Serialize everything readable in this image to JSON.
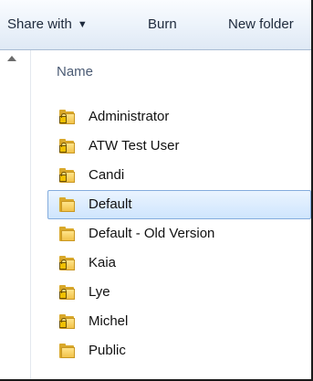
{
  "toolbar": {
    "share_with_label": "Share with",
    "burn_label": "Burn",
    "new_folder_label": "New folder"
  },
  "list": {
    "column_header": "Name",
    "items": [
      {
        "name": "Administrator",
        "icon": "locked-folder-icon"
      },
      {
        "name": "ATW Test User",
        "icon": "locked-folder-icon"
      },
      {
        "name": "Candi",
        "icon": "locked-folder-icon"
      },
      {
        "name": "Default",
        "icon": "folder-icon",
        "selected": true
      },
      {
        "name": "Default - Old Version",
        "icon": "folder-icon"
      },
      {
        "name": "Kaia",
        "icon": "locked-folder-icon"
      },
      {
        "name": "Lye",
        "icon": "locked-folder-icon"
      },
      {
        "name": "Michel",
        "icon": "locked-folder-icon"
      },
      {
        "name": "Public",
        "icon": "folder-icon"
      }
    ]
  }
}
